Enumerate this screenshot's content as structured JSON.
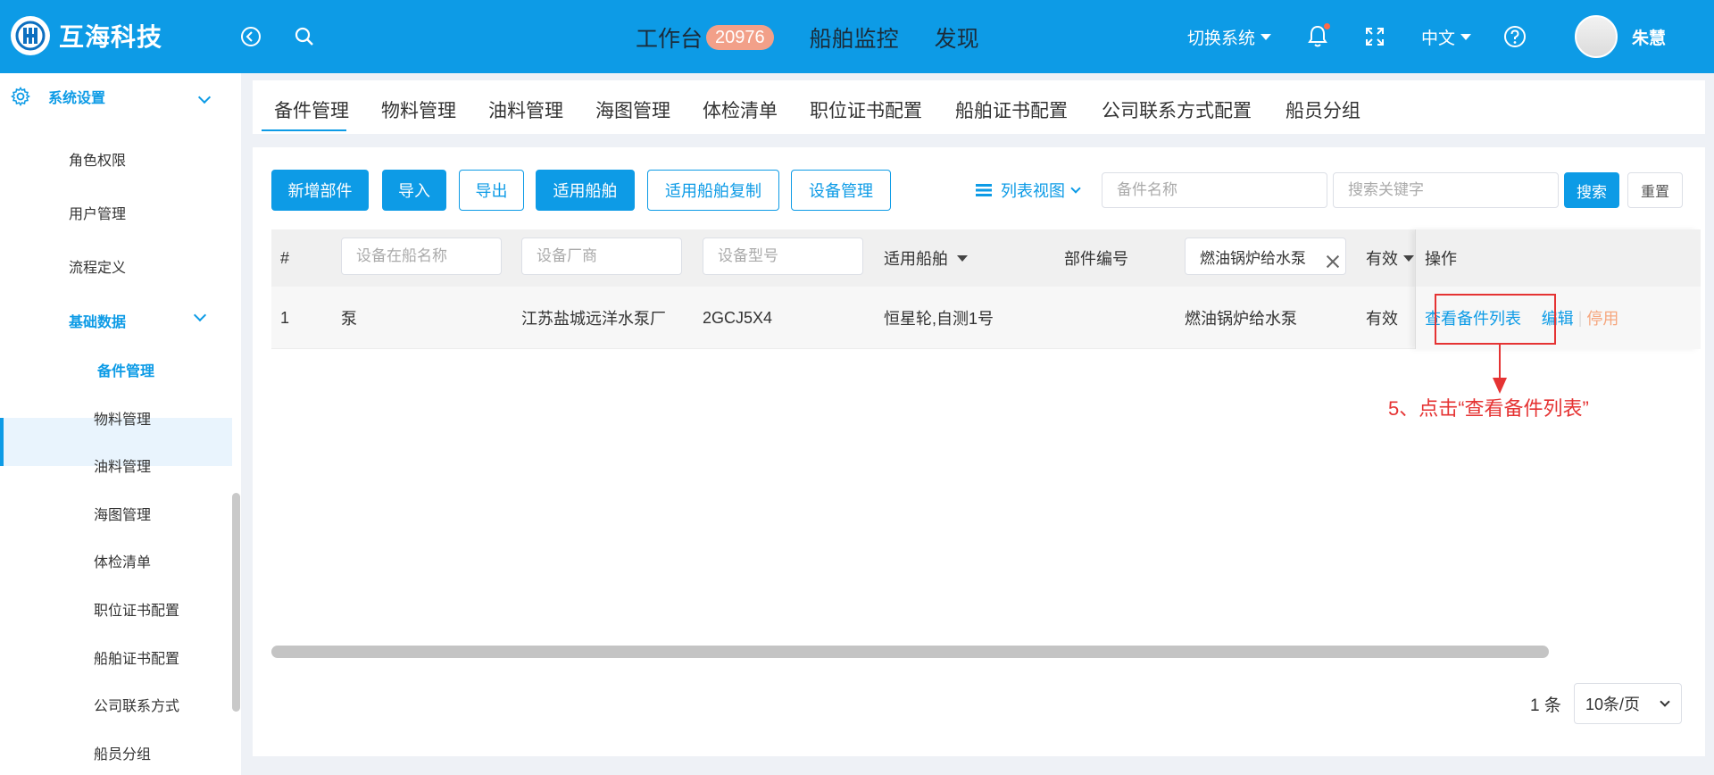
{
  "brand": {
    "name": "互海科技"
  },
  "topnav": {
    "workbench": "工作台",
    "workbench_badge": "20976",
    "ship_monitor": "船舶监控",
    "discover": "发现",
    "switch_system": "切换系统",
    "language": "中文",
    "user_name": "朱慧"
  },
  "sidebar": {
    "section": "系统设置",
    "items": [
      "角色权限",
      "用户管理",
      "流程定义"
    ],
    "group": "基础数据",
    "sub_items": [
      "备件管理",
      "物料管理",
      "油料管理",
      "海图管理",
      "体检清单",
      "职位证书配置",
      "船舶证书配置",
      "公司联系方式",
      "船员分组"
    ]
  },
  "tabs": [
    "备件管理",
    "物料管理",
    "油料管理",
    "海图管理",
    "体检清单",
    "职位证书配置",
    "船舶证书配置",
    "公司联系方式配置",
    "船员分组"
  ],
  "toolbar": {
    "add": "新增部件",
    "import": "导入",
    "export": "导出",
    "ships": "适用船舶",
    "ships_copy": "适用船舶复制",
    "device_mgmt": "设备管理",
    "view": "列表视图",
    "name_placeholder": "备件名称",
    "keyword_placeholder": "搜索关键字",
    "search": "搜索",
    "reset": "重置"
  },
  "table": {
    "headers": {
      "index": "#",
      "name_placeholder": "设备在船名称",
      "vendor_placeholder": "设备厂商",
      "model_placeholder": "设备型号",
      "ships": "适用船舶",
      "part_no": "部件编号",
      "filter_value": "燃油锅炉给水泵",
      "valid": "有效",
      "ops": "操作"
    },
    "rows": [
      {
        "index": "1",
        "name": "泵",
        "vendor": "江苏盐城远洋水泵厂",
        "model": "2GCJ5X4",
        "ships": "恒星轮,自测1号",
        "part_no": "",
        "part_name": "燃油锅炉给水泵",
        "valid": "有效",
        "op_view": "查看备件列表",
        "op_edit": "编辑",
        "op_disable": "停用"
      }
    ]
  },
  "annotation": "5、点击“查看备件列表”",
  "pagination": {
    "total": "1 条",
    "page_size": "10条/页"
  },
  "colors": {
    "primary": "#0d9be6",
    "badge": "#f2a089",
    "highlight": "#e53333",
    "warn": "#f6a77f"
  }
}
